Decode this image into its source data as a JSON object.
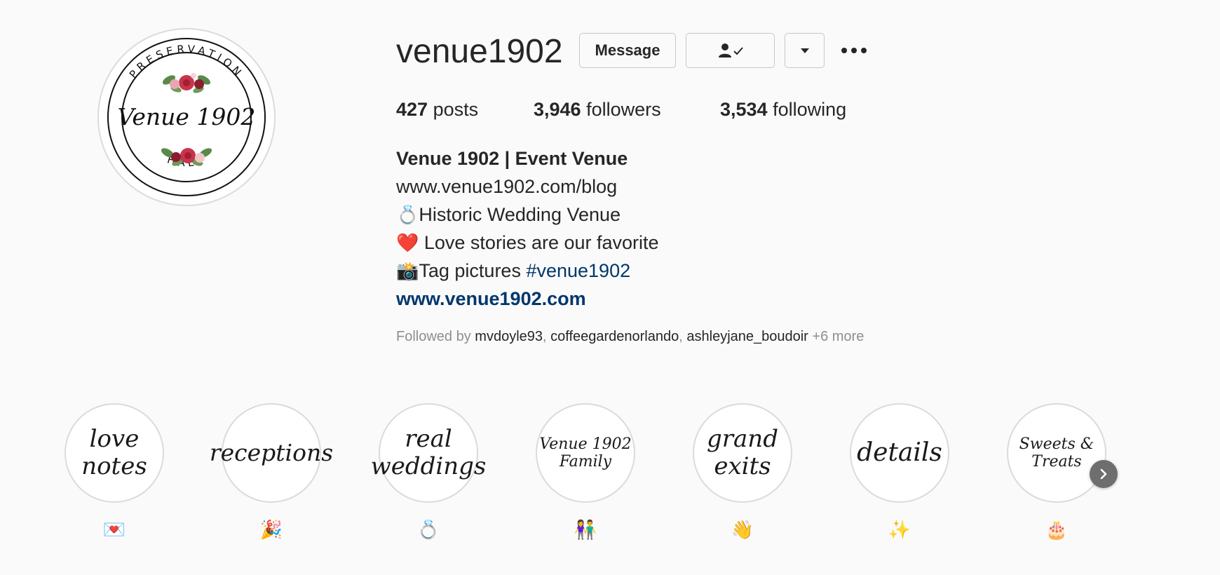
{
  "profile": {
    "username": "venue1902",
    "avatar": {
      "top_text": "PRESERVATION",
      "center_text": "Venue 1902",
      "bottom_text": "HALL"
    },
    "buttons": {
      "message_label": "Message",
      "following_icon": "person-check-icon",
      "dropdown_icon": "caret-down-icon",
      "more_icon": "ellipsis-icon"
    },
    "stats": {
      "posts_count": "427",
      "posts_label": "posts",
      "followers_count": "3,946",
      "followers_label": "followers",
      "following_count": "3,534",
      "following_label": "following"
    },
    "bio": {
      "name": "Venue 1902 | Event Venue",
      "line1": "www.venue1902.com/blog",
      "line2_emoji": "💍",
      "line2_text": "Historic Wedding Venue",
      "line3_emoji": "❤️",
      "line3_text": " Love stories are our favorite",
      "line4_emoji": "📸",
      "line4_text": "Tag pictures ",
      "hashtag": "#venue1902",
      "link": "www.venue1902.com"
    },
    "followed_by": {
      "prefix": "Followed by ",
      "users": [
        "mvdoyle93",
        "coffeegardenorlando",
        "ashleyjane_boudoir"
      ],
      "suffix": " +6 more"
    }
  },
  "highlights": [
    {
      "cover_lines": [
        "love",
        "notes"
      ],
      "label": "💌"
    },
    {
      "cover_lines": [
        "receptions"
      ],
      "label": "🎉"
    },
    {
      "cover_lines": [
        "real",
        "weddings"
      ],
      "label": "💍"
    },
    {
      "cover_lines": [
        "Venue 1902",
        "Family"
      ],
      "label": "👫"
    },
    {
      "cover_lines": [
        "grand",
        "exits"
      ],
      "label": "👋"
    },
    {
      "cover_lines": [
        "details"
      ],
      "label": "✨"
    },
    {
      "cover_lines": [
        "Sweets &",
        "Treats"
      ],
      "label": "🎂"
    }
  ],
  "highlights_nav": {
    "next_icon": "chevron-right-icon"
  },
  "colors": {
    "link": "#00376b",
    "muted": "#8e8e8e",
    "text": "#262626",
    "border": "#dbdbdb",
    "flower_red": "#c8354b",
    "leaf_green": "#5a8a4a"
  }
}
